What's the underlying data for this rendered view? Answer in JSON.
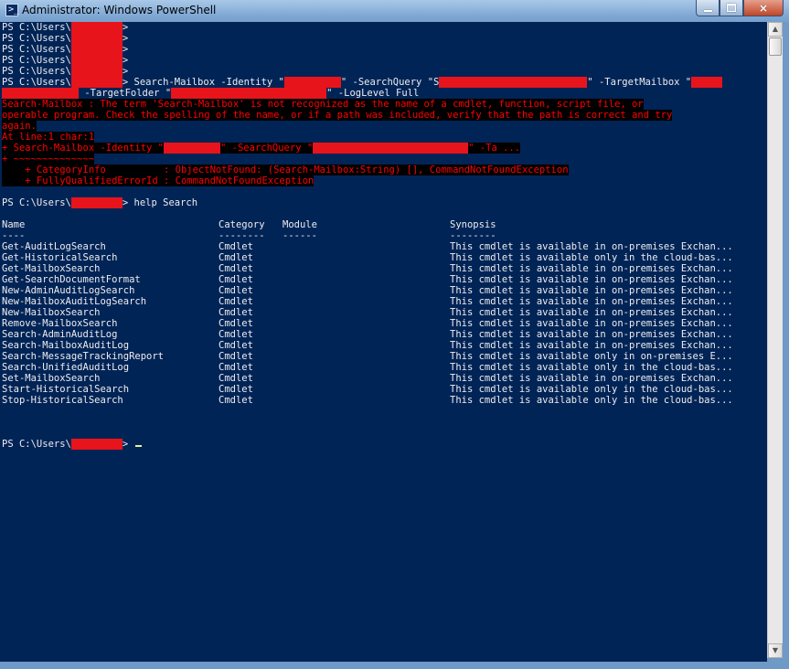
{
  "window": {
    "title": "Administrator: Windows PowerShell",
    "icon_text": ">_",
    "buttons": {
      "minimize": "minimize-icon",
      "maximize": "maximize-icon",
      "close": "×"
    }
  },
  "colors": {
    "console_bg": "#012456",
    "console_fg": "#eeedf0",
    "error_fg": "#ff0000",
    "redaction": "#e8141c"
  },
  "console": {
    "prompt_prefix": "PS C:\\Users\\",
    "prompt_suffix": ">",
    "cmd1_part1": " Search-Mailbox -Identity \"",
    "cmd1_part2": "\" -SearchQuery \"S",
    "cmd1_part3": "\" -TargetMailbox \"",
    "cmd1_cont1": " -TargetFolder \"",
    "cmd1_cont2": "\" -LogLevel Full",
    "error_lines": [
      "Search-Mailbox : The term 'Search-Mailbox' is not recognized as the name of a cmdlet, function, script file, or",
      "operable program. Check the spelling of the name, or if a path was included, verify that the path is correct and try",
      "again.",
      "At line:1 char:1"
    ],
    "error_echo_part1": "+ Search-Mailbox -Identity \"",
    "error_echo_part2": "\" -SearchQuery \"",
    "error_echo_part3": "\" -Ta ...",
    "error_underline": "+ ~~~~~~~~~~~~~~",
    "category_info": "    + CategoryInfo          : ObjectNotFound: (Search-Mailbox:String) [], CommandNotFoundException",
    "fq_error_id": "    + FullyQualifiedErrorId : CommandNotFoundException",
    "help_cmd": " help Search",
    "table": {
      "headers": {
        "name": "Name",
        "category": "Category",
        "module": "Module",
        "synopsis": "Synopsis"
      },
      "underlines": {
        "name": "----",
        "category": "--------",
        "module": "------",
        "synopsis": "--------"
      },
      "rows": [
        {
          "name": "Get-AuditLogSearch",
          "category": "Cmdlet",
          "synopsis": "This cmdlet is available in on-premises Exchan..."
        },
        {
          "name": "Get-HistoricalSearch",
          "category": "Cmdlet",
          "synopsis": "This cmdlet is available only in the cloud-bas..."
        },
        {
          "name": "Get-MailboxSearch",
          "category": "Cmdlet",
          "synopsis": "This cmdlet is available in on-premises Exchan..."
        },
        {
          "name": "Get-SearchDocumentFormat",
          "category": "Cmdlet",
          "synopsis": "This cmdlet is available in on-premises Exchan..."
        },
        {
          "name": "New-AdminAuditLogSearch",
          "category": "Cmdlet",
          "synopsis": "This cmdlet is available in on-premises Exchan..."
        },
        {
          "name": "New-MailboxAuditLogSearch",
          "category": "Cmdlet",
          "synopsis": "This cmdlet is available in on-premises Exchan..."
        },
        {
          "name": "New-MailboxSearch",
          "category": "Cmdlet",
          "synopsis": "This cmdlet is available in on-premises Exchan..."
        },
        {
          "name": "Remove-MailboxSearch",
          "category": "Cmdlet",
          "synopsis": "This cmdlet is available in on-premises Exchan..."
        },
        {
          "name": "Search-AdminAuditLog",
          "category": "Cmdlet",
          "synopsis": "This cmdlet is available in on-premises Exchan..."
        },
        {
          "name": "Search-MailboxAuditLog",
          "category": "Cmdlet",
          "synopsis": "This cmdlet is available in on-premises Exchan..."
        },
        {
          "name": "Search-MessageTrackingReport",
          "category": "Cmdlet",
          "synopsis": "This cmdlet is available only in on-premises E..."
        },
        {
          "name": "Search-UnifiedAuditLog",
          "category": "Cmdlet",
          "synopsis": "This cmdlet is available only in the cloud-bas..."
        },
        {
          "name": "Set-MailboxSearch",
          "category": "Cmdlet",
          "synopsis": "This cmdlet is available in on-premises Exchan..."
        },
        {
          "name": "Start-HistoricalSearch",
          "category": "Cmdlet",
          "synopsis": "This cmdlet is available only in the cloud-bas..."
        },
        {
          "name": "Stop-HistoricalSearch",
          "category": "Cmdlet",
          "synopsis": "This cmdlet is available only in the cloud-bas..."
        }
      ]
    },
    "final_prompt_suffix": "> "
  }
}
